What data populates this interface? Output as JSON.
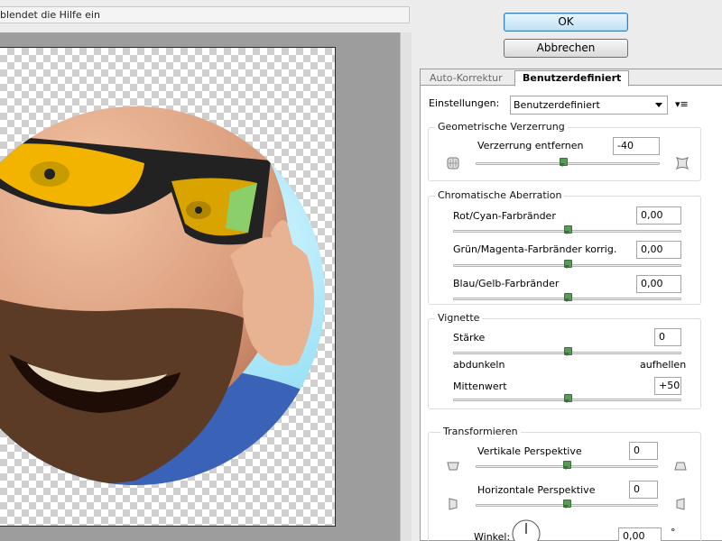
{
  "hint_text": "blendet die Hilfe ein",
  "buttons": {
    "ok": "OK",
    "cancel": "Abbrechen"
  },
  "tabs": {
    "auto": "Auto-Korrektur",
    "custom": "Benutzerdefiniert"
  },
  "settings": {
    "label": "Einstellungen:",
    "value": "Benutzerdefiniert",
    "menu_icon": "▾≡"
  },
  "geometric": {
    "title": "Geometrische Verzerrung",
    "remove_label": "Verzerrung entfernen",
    "remove_value": "-40",
    "slider_fraction": 0.4
  },
  "chromatic": {
    "title": "Chromatische Aberration",
    "rows": [
      {
        "label": "Rot/Cyan-Farbränder",
        "value": "0,00"
      },
      {
        "label": "Grün/Magenta-Farbränder korrig.",
        "value": "0,00"
      },
      {
        "label": "Blau/Gelb-Farbränder",
        "value": "0,00"
      }
    ]
  },
  "vignette": {
    "title": "Vignette",
    "strength_label": "Stärke",
    "strength_value": "0",
    "darken_label": "abdunkeln",
    "lighten_label": "aufhellen",
    "midpoint_label": "Mittenwert",
    "midpoint_value": "+50"
  },
  "transform": {
    "title": "Transformieren",
    "vertical_label": "Vertikale Perspektive",
    "vertical_value": "0",
    "horizontal_label": "Horizontale Perspektive",
    "horizontal_value": "0",
    "angle_label": "Winkel:",
    "angle_value": "0,00",
    "degree_symbol": "°"
  },
  "colors": {
    "accent": "#3c7fb1",
    "thumb": "#5a9b5a"
  }
}
